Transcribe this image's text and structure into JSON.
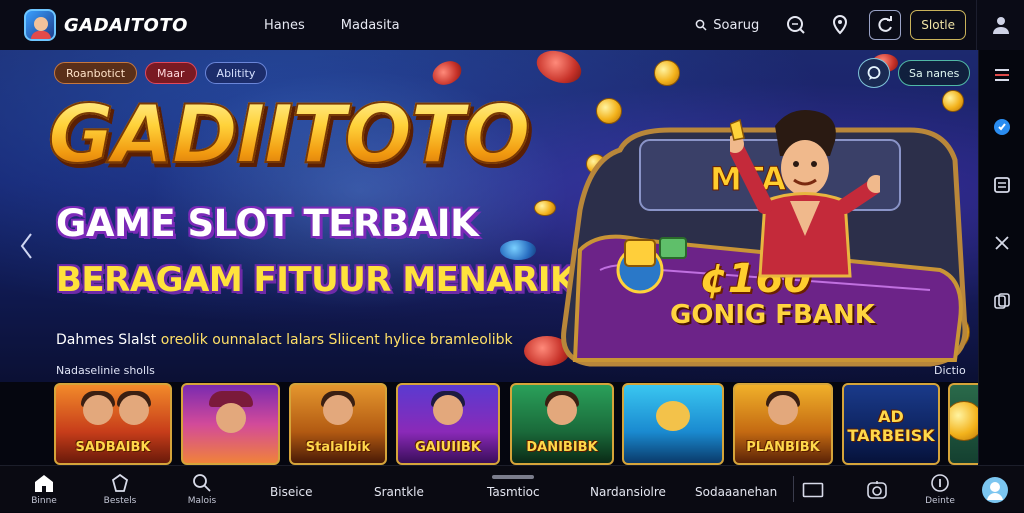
{
  "header": {
    "brand": "GADAITOTO",
    "nav": [
      "Hanes",
      "Madasita"
    ],
    "search_label": "Soarug",
    "mobile_button": "Slotle"
  },
  "hero": {
    "pills": [
      "Roanbotict",
      "Maar",
      "Ablitity"
    ],
    "share_label": "Sa nanes",
    "title": "GADIITOTO",
    "subtitle_1": "GAME SLOT TERBAIK",
    "subtitle_2": "BERAGAM FITUUR MENARIK",
    "description_lead": "Dahmes Slalst",
    "description_rest": "oreolik ounnalact lalars Sliicent hylice bramleolibk",
    "jackpot_amount": "¢160",
    "jackpot_caption": "GONIG FBANK",
    "machine_label": "MTA"
  },
  "section": {
    "label": "Nadaselinie sholls",
    "more": "Dictio"
  },
  "games": [
    {
      "name": "SADBAIBK"
    },
    {
      "name": ""
    },
    {
      "name": "Stalalbik"
    },
    {
      "name": "GAIUIIBK"
    },
    {
      "name": "DANIBIBK"
    },
    {
      "name": ""
    },
    {
      "name": "PLANBIBK"
    },
    {
      "name": "AD TARBEISK"
    },
    {
      "name": ""
    }
  ],
  "bottom_nav": {
    "home": "Binne",
    "games": "Bestels",
    "search": "Malois",
    "text_items": [
      "Biseice",
      "Srantkle",
      "Tasmtioc",
      "Nardansiolre",
      "Sodaaanehan"
    ],
    "info": "Deinte"
  },
  "colors": {
    "accent_gold": "#ffd23a",
    "title_purple_outline": "#7b2ab8",
    "tile_border": "#d5a43a",
    "background": "#05060f"
  },
  "icons": {
    "top": [
      "search-icon",
      "chat-bubble-icon",
      "location-pin-icon",
      "refresh-icon",
      "shield-icon"
    ],
    "rail": [
      "menu-icon",
      "notification-icon",
      "document-icon",
      "close-icon",
      "copy-icon"
    ],
    "bottom": [
      "home-icon",
      "gamepad-icon",
      "search-icon",
      "window-icon",
      "clock-icon",
      "info-icon",
      "avatar-icon"
    ]
  }
}
